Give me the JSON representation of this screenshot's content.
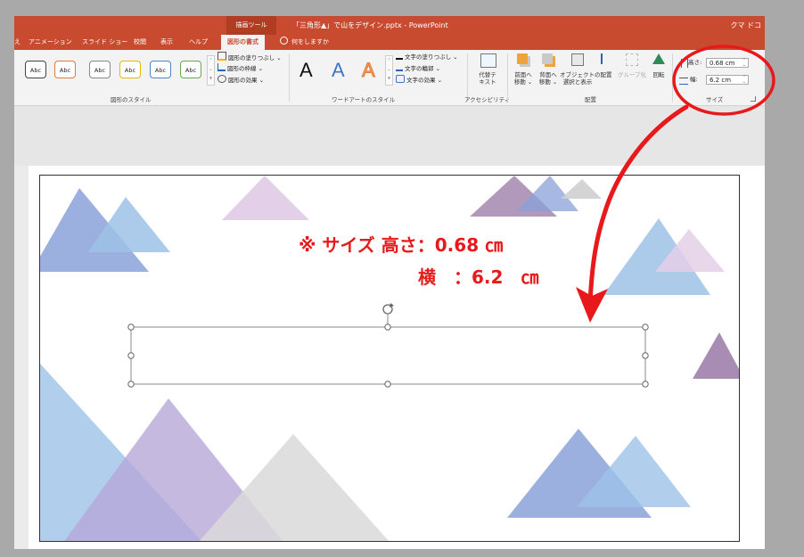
{
  "window": {
    "contextual_tab_group": "描画ツール",
    "doc_title": "「三角形▲」で山をデザイン.pptx  -  PowerPoint",
    "user": "クマ ドコ"
  },
  "tabs": [
    {
      "label": "え"
    },
    {
      "label": "アニメーション"
    },
    {
      "label": "スライド ショー"
    },
    {
      "label": "校閲"
    },
    {
      "label": "表示"
    },
    {
      "label": "ヘルプ"
    },
    {
      "label": "図形の書式"
    }
  ],
  "tell_me": "何をしますか",
  "ribbon": {
    "shape_styles": {
      "label": "図形のスタイル",
      "swatches": [
        {
          "text": "Abc",
          "color": "#444444"
        },
        {
          "text": "Abc",
          "color": "#e07b39"
        },
        {
          "text": "Abc",
          "color": "#888888"
        },
        {
          "text": "Abc",
          "color": "#e6b800"
        },
        {
          "text": "Abc",
          "color": "#4a86c8"
        },
        {
          "text": "Abc",
          "color": "#6aa84f"
        }
      ],
      "fill": "図形の塗りつぶし ⌄",
      "outline": "図形の枠線 ⌄",
      "effects": "図形の効果 ⌄"
    },
    "wordart": {
      "label": "ワードアートのスタイル",
      "letters": [
        "A",
        "A",
        "A"
      ],
      "text_fill": "文字の塗りつぶし ⌄",
      "text_outline": "文字の輪郭 ⌄",
      "text_effects": "文字の効果 ⌄"
    },
    "accessibility": {
      "label": "アクセシビリティ",
      "alt_text_1": "代替テ",
      "alt_text_2": "キスト"
    },
    "arrange": {
      "label": "配置",
      "bring_forward_1": "前面へ",
      "bring_forward_2": "移動 ⌄",
      "send_backward_1": "背面へ",
      "send_backward_2": "移動 ⌄",
      "selection_pane_1": "オブジェクトの",
      "selection_pane_2": "選択と表示",
      "align": "配置",
      "group": "グループ化",
      "rotate": "回転"
    },
    "size": {
      "label": "サイズ",
      "height_label": "高さ:",
      "height_value": "0.68 cm",
      "width_label": "幅:",
      "width_value": "6.2 cm"
    }
  },
  "annotation": {
    "line1": "※ サイズ  高さ：0.68 ㎝",
    "line2": "横　：6.2　㎝",
    "color": "#e8191a"
  }
}
